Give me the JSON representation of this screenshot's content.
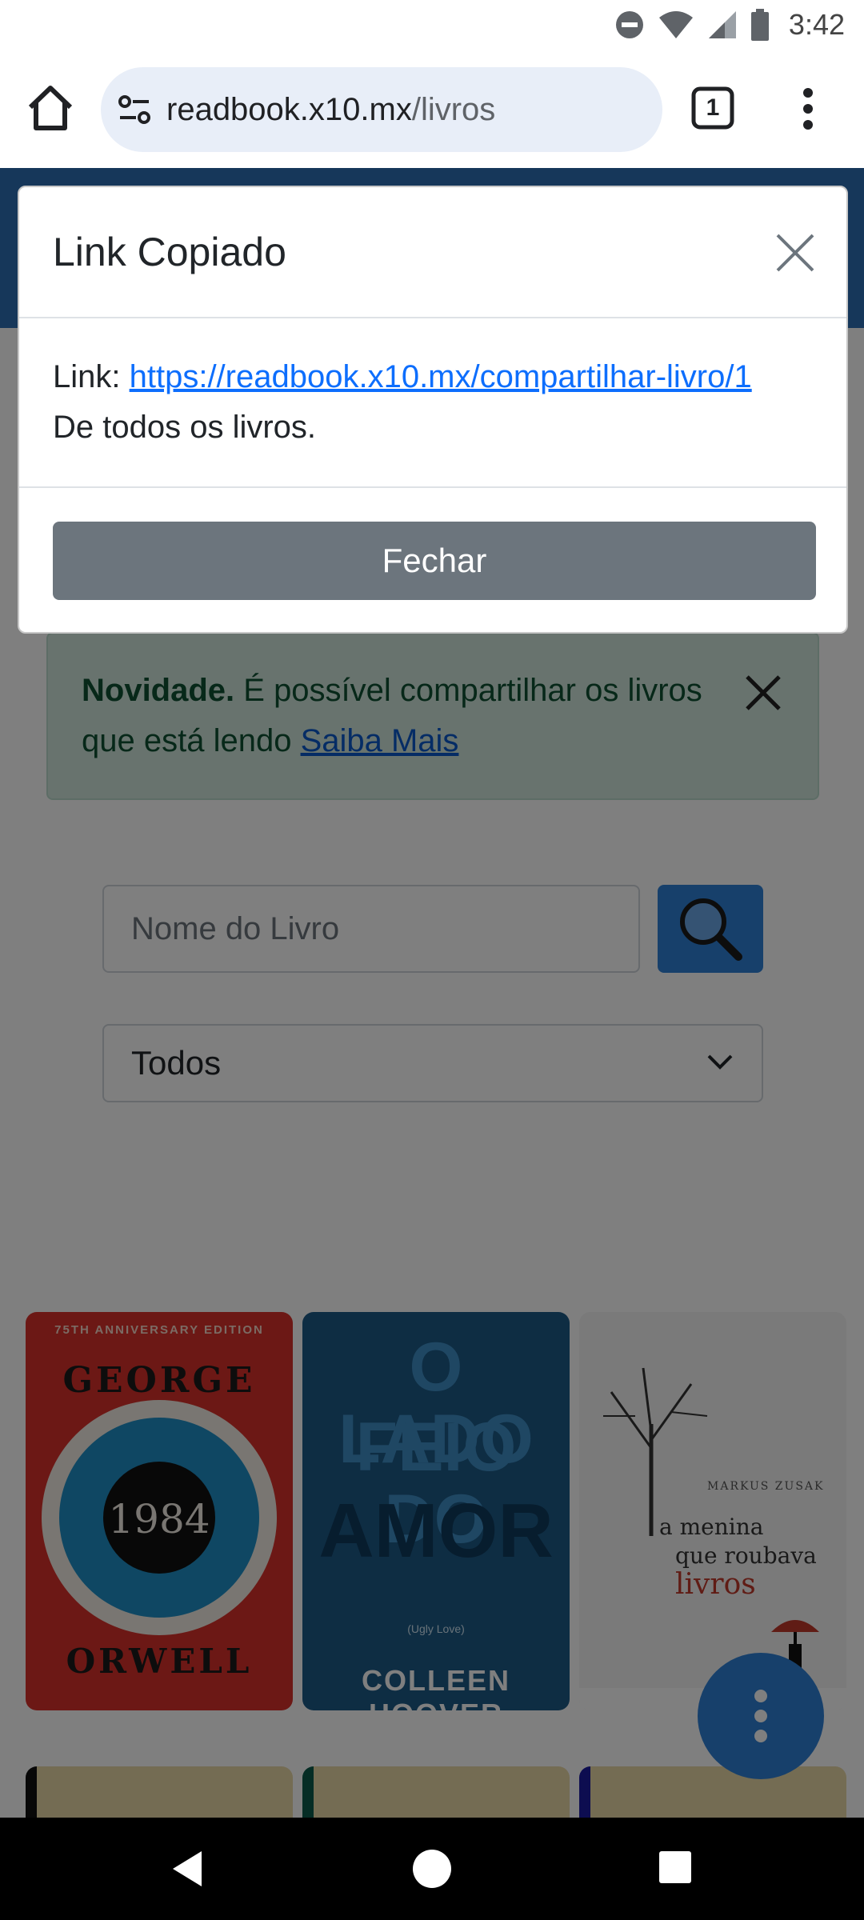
{
  "status_bar": {
    "time": "3:42"
  },
  "browser": {
    "url_host": "readbook.x10.mx",
    "url_path": "/livros",
    "tab_count": "1"
  },
  "notice": {
    "bold": "Novidade.",
    "text": " É possível compartilhar os livros que está lendo ",
    "link": "Saiba Mais"
  },
  "search": {
    "placeholder": "Nome do Livro"
  },
  "filter": {
    "selected": "Todos"
  },
  "books": [
    {
      "edition": "75TH ANNIVERSARY EDITION",
      "author_top": "GEORGE",
      "title": "1984",
      "author_bottom": "ORWELL"
    },
    {
      "title_line1": "O LADO",
      "title_line2": "FEIO DO",
      "title_line3": "AMOR",
      "subtitle": "(Ugly Love)",
      "author": "COLLEEN HOOVER"
    },
    {
      "author": "MARKUS ZUSAK",
      "title_line1": "a menina",
      "title_line2": "que roubava",
      "title_line3": "livros"
    }
  ],
  "modal": {
    "title": "Link Copiado",
    "link_label": "Link: ",
    "link_url": "https://readbook.x10.mx/compartilhar-livro/1",
    "description": "De todos os livros.",
    "close_button": "Fechar"
  },
  "colors": {
    "header_blue": "#2c6fb4",
    "button_blue": "#2f80d6",
    "secondary_button": "#6c757d",
    "notice_bg": "#d1e7dd",
    "link": "#0d6efd"
  }
}
